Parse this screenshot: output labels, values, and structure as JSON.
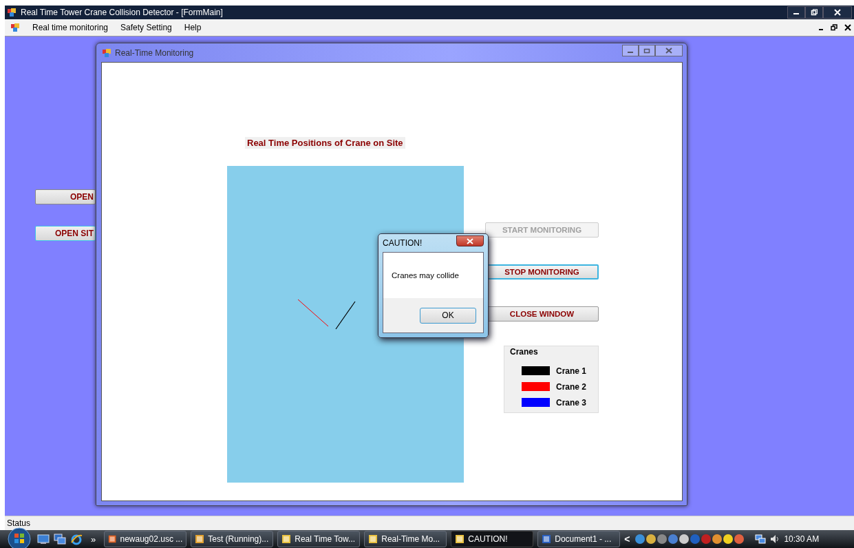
{
  "main_window": {
    "title": "Real Time Tower Crane Collision Detector - [FormMain]"
  },
  "menu": [
    {
      "label": "Real time monitoring"
    },
    {
      "label": "Safety Setting"
    },
    {
      "label": "Help"
    }
  ],
  "background_buttons": [
    {
      "label": "OPEN",
      "focused": false
    },
    {
      "label": "OPEN SIT",
      "focused": true
    }
  ],
  "monitoring_window": {
    "title": "Real-Time Monitoring",
    "heading": "Real Time Positions of Crane on Site",
    "buttons": [
      {
        "label": "START MONITORING",
        "disabled": true,
        "focused": false
      },
      {
        "label": "STOP MONITORING",
        "disabled": false,
        "focused": true
      },
      {
        "label": "CLOSE WINDOW",
        "disabled": false,
        "focused": false
      }
    ],
    "legend": {
      "title": "Cranes",
      "items": [
        {
          "label": "Crane 1",
          "color": "#000000"
        },
        {
          "label": "Crane 2",
          "color": "#ff0000"
        },
        {
          "label": "Crane 3",
          "color": "#0000ff"
        }
      ]
    }
  },
  "dialog": {
    "title": "CAUTION!",
    "message": "Cranes may collide",
    "button": "OK"
  },
  "status_bar": {
    "text": "Status"
  },
  "taskbar": {
    "overflow": "»",
    "tasks": [
      {
        "label": "newaug02.usc ...",
        "selected": false
      },
      {
        "label": "Test (Running)...",
        "selected": false
      },
      {
        "label": "Real Time Tow...",
        "selected": false
      },
      {
        "label": "Real-Time Mo...",
        "selected": false
      },
      {
        "label": "CAUTION!",
        "selected": true
      },
      {
        "label": "Document1 - ...",
        "selected": false
      }
    ],
    "tray_arrow": "<",
    "clock": "10:30 AM"
  }
}
